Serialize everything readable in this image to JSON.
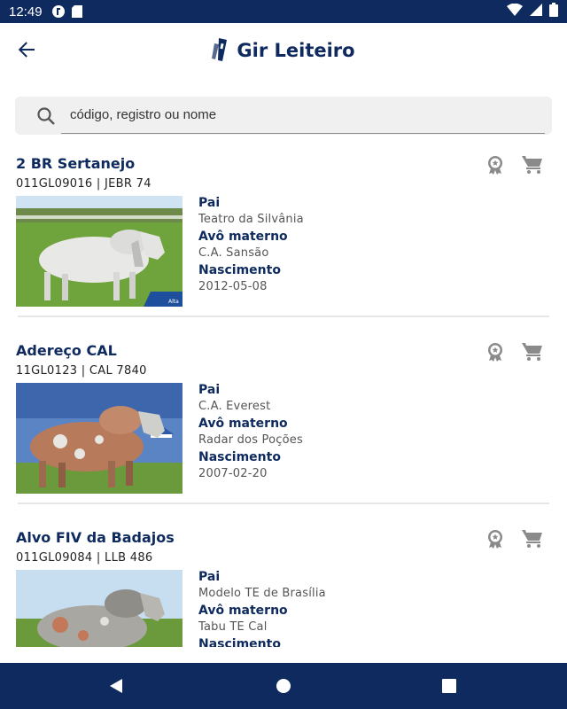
{
  "status_bar": {
    "time": "12:49"
  },
  "header": {
    "title": "Gir Leiteiro"
  },
  "search": {
    "placeholder": "código, registro ou nome"
  },
  "labels": {
    "pai": "Pai",
    "avo_materno": "Avô materno",
    "nascimento": "Nascimento"
  },
  "photo_badge": "Alta",
  "bulls": [
    {
      "name": "2 BR Sertanejo",
      "code": "011GL09016 | JEBR 74",
      "pai": "Teatro da Silvânia",
      "avo_materno": "C.A. Sansão",
      "nascimento": "2012-05-08"
    },
    {
      "name": "Adereço CAL",
      "code": "11GL0123 | CAL 7840",
      "pai": "C.A. Everest",
      "avo_materno": "Radar dos Poções",
      "nascimento": "2007-02-20"
    },
    {
      "name": "Alvo FIV da Badajos",
      "code": "011GL09084 | LLB 486",
      "pai": "Modelo TE de Brasília",
      "avo_materno": "Tabu TE Cal",
      "nascimento": ""
    }
  ]
}
